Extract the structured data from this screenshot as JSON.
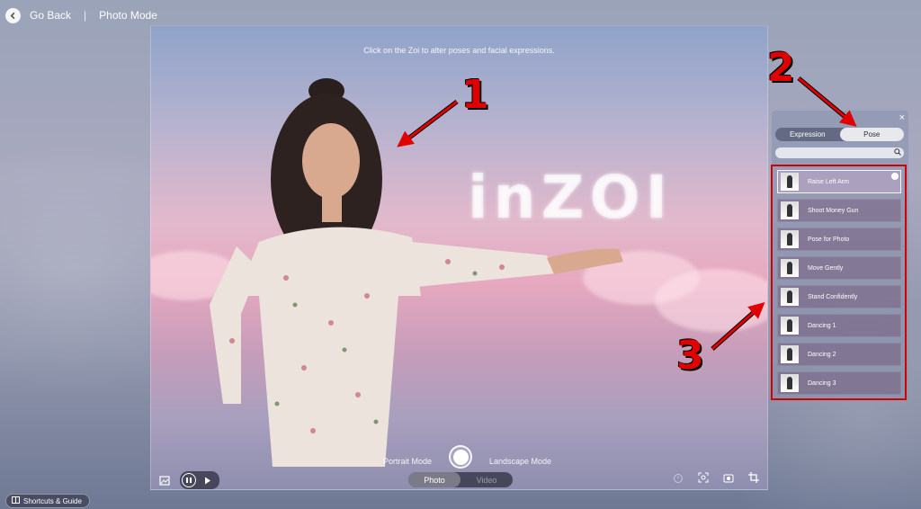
{
  "topbar": {
    "back_label": "Go Back",
    "separator": "|",
    "title": "Photo Mode"
  },
  "viewport": {
    "hint": "Click on the Zoi to alter poses and facial expressions.",
    "logo_text": "inZOI"
  },
  "capture": {
    "portrait_label": "Portrait Mode",
    "landscape_label": "Landscape Mode",
    "photo_tab": "Photo",
    "video_tab": "Video"
  },
  "panel": {
    "close_glyph": "×",
    "tabs": [
      {
        "label": "Expression",
        "active": false
      },
      {
        "label": "Pose",
        "active": true
      }
    ],
    "search_placeholder": "",
    "poses": [
      {
        "label": "Raise Left Arm",
        "selected": true
      },
      {
        "label": "Shoot Money Gun",
        "selected": false
      },
      {
        "label": "Pose for Photo",
        "selected": false
      },
      {
        "label": "Move Gently",
        "selected": false
      },
      {
        "label": "Stand Confidently",
        "selected": false
      },
      {
        "label": "Dancing 1",
        "selected": false
      },
      {
        "label": "Dancing 2",
        "selected": false
      },
      {
        "label": "Dancing 3",
        "selected": false
      }
    ]
  },
  "annotations": {
    "one": "1",
    "two": "2",
    "three": "3"
  },
  "footer": {
    "shortcuts_label": "Shortcuts & Guide"
  },
  "colors": {
    "annotation_red": "#e00000",
    "highlight_border": "#d40000"
  }
}
